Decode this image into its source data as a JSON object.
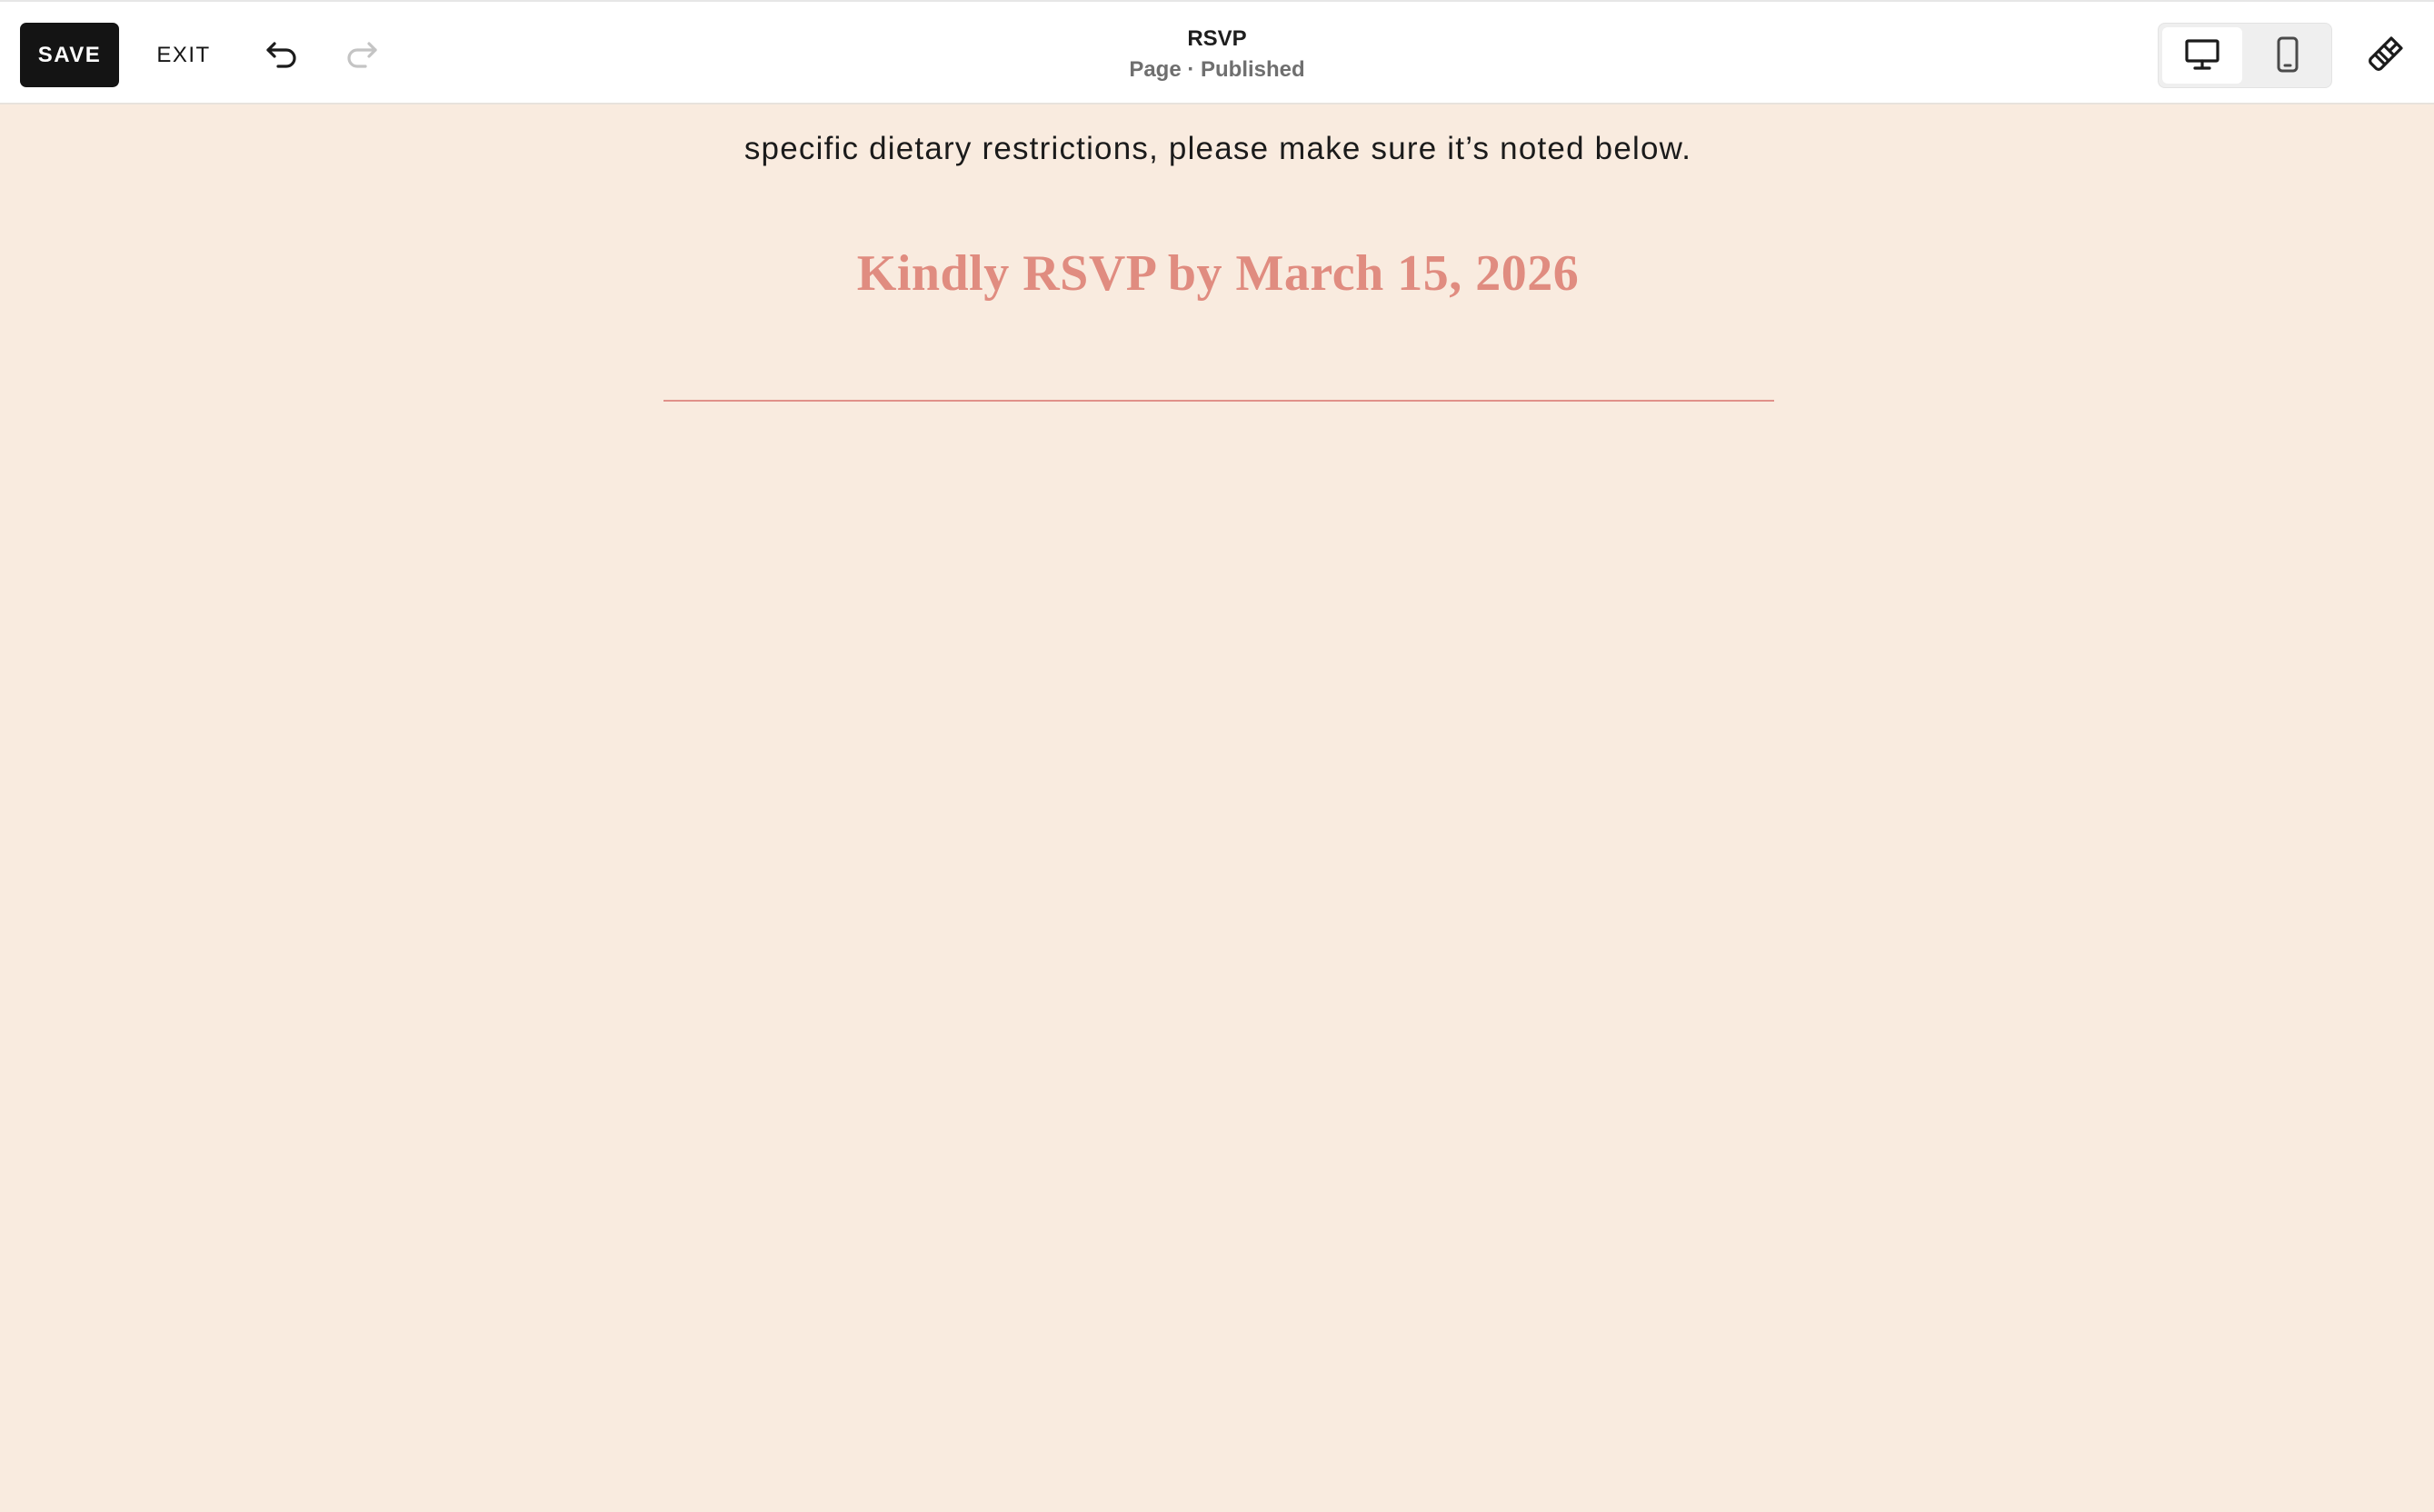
{
  "toolbar": {
    "save_label": "SAVE",
    "exit_label": "EXIT",
    "undo_icon": "undo-icon",
    "redo_icon": "redo-icon",
    "page_title": "RSVP",
    "page_subtitle": "Page · Published",
    "device_toggle": {
      "desktop_icon": "desktop-icon",
      "mobile_icon": "mobile-icon",
      "selected": "desktop"
    },
    "design_icon": "paintbrush-icon"
  },
  "content": {
    "body_text": "specific dietary restrictions, please make sure it’s noted below.",
    "deadline": "Kindly RSVP by March 15, 2026"
  },
  "colors": {
    "page_background": "#f9ebdf",
    "accent": "#e08c80",
    "save_button": "#141414"
  }
}
